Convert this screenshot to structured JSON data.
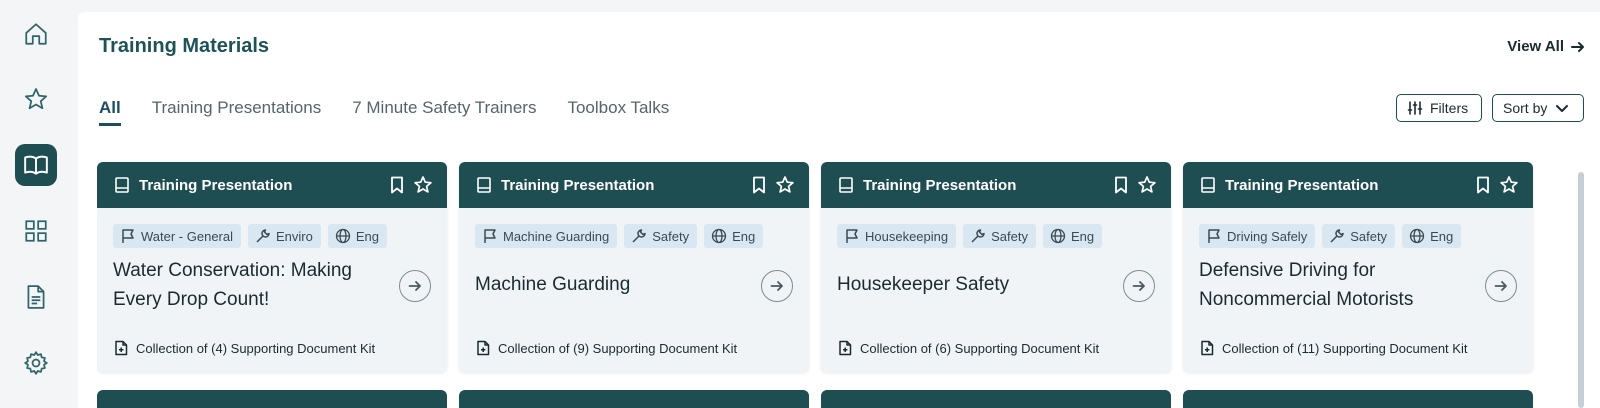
{
  "sidebar": {
    "items": [
      {
        "name": "home"
      },
      {
        "name": "favorites"
      },
      {
        "name": "training-materials",
        "active": true
      },
      {
        "name": "dashboard"
      },
      {
        "name": "documents"
      },
      {
        "name": "settings"
      }
    ]
  },
  "header": {
    "title": "Training Materials",
    "view_all": "View All"
  },
  "tabs": [
    {
      "label": "All",
      "active": true
    },
    {
      "label": "Training Presentations"
    },
    {
      "label": "7 Minute Safety Trainers"
    },
    {
      "label": "Toolbox Talks"
    }
  ],
  "toolbar": {
    "filters_label": "Filters",
    "sort_label": "Sort by"
  },
  "cards": [
    {
      "type": "Training Presentation",
      "tags": [
        "Water - General",
        "Enviro",
        "Eng"
      ],
      "title": "Water Conservation: Making Every Drop Count!",
      "footer": "Collection of (4) Supporting Document Kit"
    },
    {
      "type": "Training Presentation",
      "tags": [
        "Machine Guarding",
        "Safety",
        "Eng"
      ],
      "title": "Machine Guarding",
      "footer": "Collection of (9) Supporting Document Kit"
    },
    {
      "type": "Training Presentation",
      "tags": [
        "Housekeeping",
        "Safety",
        "Eng"
      ],
      "title": "Housekeeper Safety",
      "footer": "Collection of (6) Supporting Document Kit"
    },
    {
      "type": "Training Presentation",
      "tags": [
        "Driving Safely",
        "Safety",
        "Eng"
      ],
      "title": "Defensive Driving for Noncommercial Motorists",
      "footer": "Collection of (11) Supporting Document Kit"
    }
  ],
  "colors": {
    "brand": "#1e4d52",
    "tag_bg": "#d9e7f2",
    "card_bg": "#f1f4f7"
  }
}
